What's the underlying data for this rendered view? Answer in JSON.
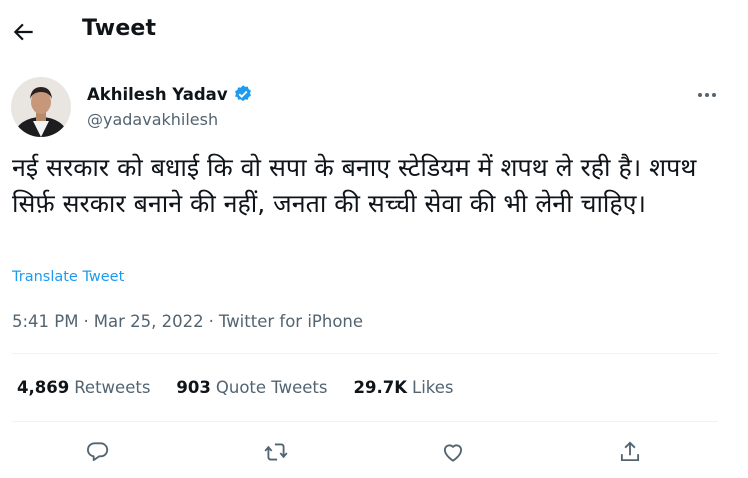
{
  "header": {
    "title": "Tweet",
    "back_icon": "arrow-left-icon"
  },
  "author": {
    "name": "Akhilesh Yadav",
    "handle": "@yadavakhilesh",
    "verified": true,
    "verified_color": "#1d9bf0"
  },
  "tweet": {
    "text": "नई सरकार को बधाई कि वो सपा के बनाए स्टेडियम में शपथ ले रही है। शपथ सिर्फ़ सरकार बनाने की नहीं, जनता की सच्ची सेवा की भी लेनी चाहिए।",
    "translate_label": "Translate Tweet",
    "time": "5:41 PM",
    "separator": "·",
    "date": "Mar 25, 2022",
    "separator2": "·",
    "source": "Twitter for iPhone"
  },
  "stats": {
    "retweets_count": "4,869",
    "retweets_label": "Retweets",
    "quotes_count": "903",
    "quotes_label": "Quote Tweets",
    "likes_count": "29.7K",
    "likes_label": "Likes"
  },
  "actions": [
    "reply-icon",
    "retweet-icon",
    "like-icon",
    "share-icon"
  ],
  "colors": {
    "accent": "#1d9bf0",
    "text": "#0f1419",
    "secondary": "#536471",
    "divider": "#eff3f4"
  }
}
